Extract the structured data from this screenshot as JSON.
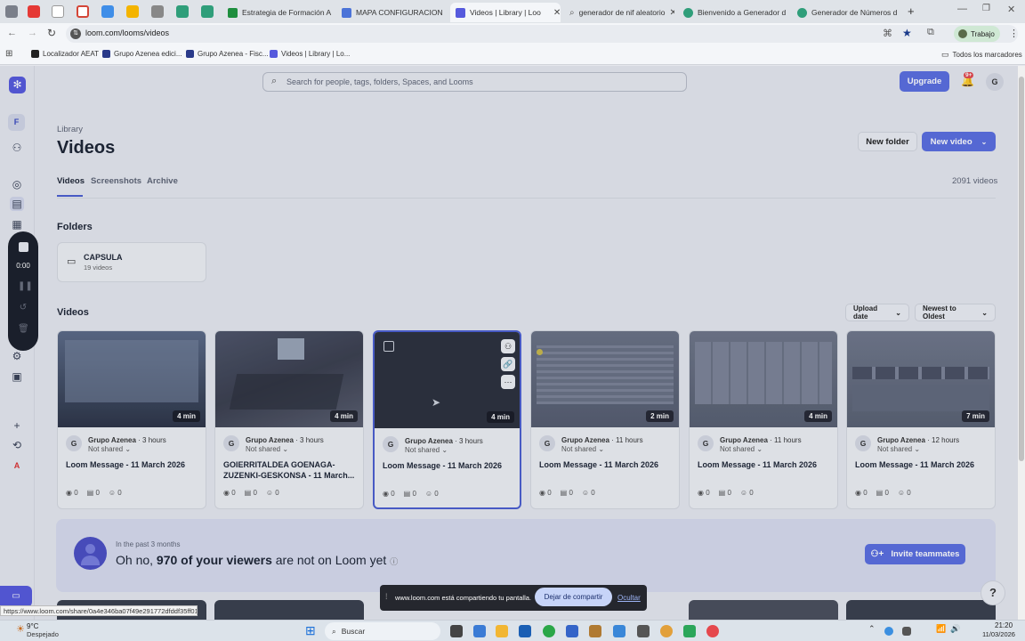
{
  "browser": {
    "tabs": [
      {
        "label": "Estrategia de Formación A",
        "color": "#1e8e3e"
      },
      {
        "label": "MAPA CONFIGURACION",
        "color": "#4b73d8"
      },
      {
        "label": "Videos | Library | Loo",
        "color": "#565add"
      },
      {
        "label": "generador de nif aleatorio",
        "color": "#888888"
      },
      {
        "label": "Bienvenido a Generador d",
        "color": "#2f9e7a"
      },
      {
        "label": "Generador de Números d",
        "color": "#2f9e7a"
      }
    ],
    "url": "loom.com/looms/videos",
    "profile_label": "Trabajo",
    "bookmarks": [
      "Localizador AEAT",
      "Grupo Azenea edici...",
      "Grupo Azenea - Fisc...",
      "Videos | Library | Lo..."
    ],
    "all_bookmarks_label": "Todos los marcadores"
  },
  "rail": {
    "workspace_initial": "F",
    "recorder_time": "0:00",
    "user_initial": "A"
  },
  "header": {
    "search_placeholder": "Search for people, tags, folders, Spaces, and Looms",
    "upgrade_label": "Upgrade",
    "notification_count": "9+",
    "avatar_initial": "G"
  },
  "page": {
    "breadcrumb": "Library",
    "title": "Videos",
    "new_folder_label": "New folder",
    "new_video_label": "New video",
    "tabs": [
      "Videos",
      "Screenshots",
      "Archive"
    ],
    "video_count": "2091 videos",
    "folders_heading": "Folders",
    "folder": {
      "name": "CAPSULA",
      "count": "19 videos"
    },
    "videos_heading": "Videos",
    "sort_upload": "Upload date",
    "sort_order": "Newest to Oldest"
  },
  "videos": [
    {
      "duration": "4 min",
      "owner": "Grupo Azenea",
      "time": "3 hours",
      "share": "Not shared",
      "title": "Loom Message - 11 March 2026",
      "views": "0",
      "comments": "0",
      "reactions": "0"
    },
    {
      "duration": "4 min",
      "owner": "Grupo Azenea",
      "time": "3 hours",
      "share": "Not shared",
      "title": "GOIERRITALDEA GOENAGA-ZUZENKI-GESKONSA - 11 March...",
      "views": "0",
      "comments": "0",
      "reactions": "0"
    },
    {
      "duration": "4 min",
      "owner": "Grupo Azenea",
      "time": "3 hours",
      "share": "Not shared",
      "title": "Loom Message - 11 March 2026",
      "views": "0",
      "comments": "0",
      "reactions": "0"
    },
    {
      "duration": "2 min",
      "owner": "Grupo Azenea",
      "time": "11 hours",
      "share": "Not shared",
      "title": "Loom Message - 11 March 2026",
      "views": "0",
      "comments": "0",
      "reactions": "0"
    },
    {
      "duration": "4 min",
      "owner": "Grupo Azenea",
      "time": "11 hours",
      "share": "Not shared",
      "title": "Loom Message - 11 March 2026",
      "views": "0",
      "comments": "0",
      "reactions": "0"
    },
    {
      "duration": "7 min",
      "owner": "Grupo Azenea",
      "time": "12 hours",
      "share": "Not shared",
      "title": "Loom Message - 11 March 2026",
      "views": "0",
      "comments": "0",
      "reactions": "0"
    }
  ],
  "banner": {
    "subtitle": "In the past 3 months",
    "text_pre": "Oh no, ",
    "text_bold": "970 of your viewers",
    "text_post": " are not on Loom yet",
    "invite_label": "Invite teammates"
  },
  "share_bar": {
    "message": "www.loom.com está compartiendo tu pantalla.",
    "stop_label": "Dejar de compartir",
    "hide_label": "Ocultar"
  },
  "status_url": "https://www.loom.com/share/0a4e346ba07f49e291772dfddf35ff01",
  "taskbar": {
    "temperature": "9°C",
    "weather": "Despejado",
    "search_label": "Buscar",
    "time": "21:20",
    "date": "11/03/2026"
  },
  "colors": {
    "accent": "#5b6ee0",
    "loom_brand": "#565add"
  }
}
